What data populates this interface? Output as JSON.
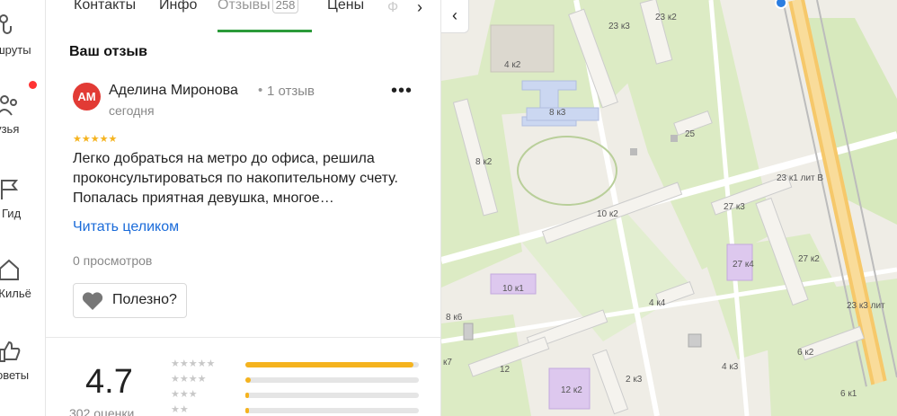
{
  "sidebar": {
    "items": [
      {
        "label": "ршруты",
        "icon": "routes-icon"
      },
      {
        "label": "рузья",
        "icon": "friends-icon"
      },
      {
        "label": "Гид",
        "icon": "flag-icon"
      },
      {
        "label": "Жильё",
        "icon": "house-icon"
      },
      {
        "label": "оветы",
        "icon": "thumbs-up-icon"
      }
    ]
  },
  "tabs": [
    {
      "label": "Контакты"
    },
    {
      "label": "Инфо"
    },
    {
      "label": "Отзывы",
      "badge": "258"
    },
    {
      "label": "Цены"
    },
    {
      "label": "Ф"
    }
  ],
  "review": {
    "section_title": "Ваш отзыв",
    "avatar_initials": "АМ",
    "author": "Аделина Миронова",
    "separator": "•",
    "author_reviews": "1 отзыв",
    "date": "сегодня",
    "stars": "★★★★★",
    "text": "Легко добраться на метро до офиса, решила проконсультироваться по накопительному счету. Попалась приятная девушка, многое…",
    "read_more": "Читать целиком",
    "views": "0 просмотров",
    "helpful": "Полезно?"
  },
  "summary": {
    "rating": "4.7",
    "count": "302 оценки",
    "distribution": [
      {
        "stars": "★★★★★",
        "share": 0.97
      },
      {
        "stars": "★★★★",
        "share": 0.03
      },
      {
        "stars": "★★★",
        "share": 0.02
      },
      {
        "stars": "★★",
        "share": 0.02
      }
    ]
  },
  "map": {
    "labels": [
      "23 к3",
      "23 к2",
      "4 к2",
      "8 к3",
      "25",
      "8 к2",
      "23 к1 лит В",
      "10 к2",
      "27 к3",
      "27 к4",
      "27 к2",
      "10 к1",
      "4 к4",
      "23 к3 лит",
      "8 к6",
      "12",
      "4 к3",
      "6 к2",
      "12 к2",
      "2 к3",
      "6 к1",
      "к7"
    ]
  },
  "colors": {
    "accent_green": "#2b9b3a",
    "star": "#f5b31e",
    "link": "#1a6bd9",
    "avatar": "#e23b35",
    "notification": "#ff3333"
  }
}
